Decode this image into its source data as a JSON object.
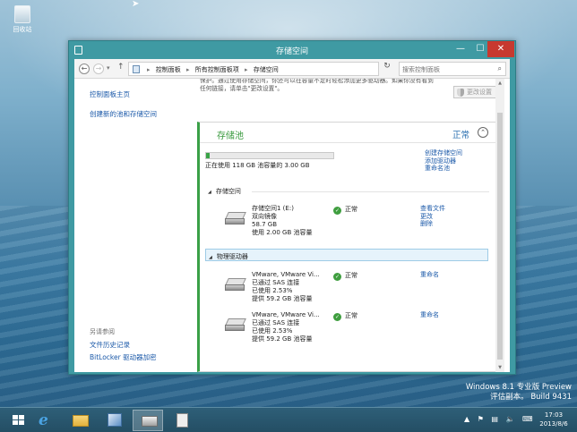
{
  "desktop": {
    "recycle_bin_label": "回收站",
    "watermark_line1": "Windows 8.1 专业版 Preview",
    "watermark_line2": "评估副本。 Build 9431"
  },
  "window": {
    "title": "存储空间",
    "close_glyph": "✕",
    "min_glyph": "—",
    "max_glyph": "☐"
  },
  "address": {
    "crumbs": [
      "控制面板",
      "所有控制面板项",
      "存储空间"
    ],
    "search_placeholder": "搜索控制面板"
  },
  "left_nav": {
    "links": [
      "控制面板主页",
      "创建新的池和存储空间"
    ],
    "see_also_heading": "另请参阅",
    "see_also_links": [
      "文件历史记录",
      "BitLocker 驱动器加密"
    ]
  },
  "intro": {
    "text": "保护。通过使用存储空间，你还可以在容量不足时轻松添加更多驱动器。如果你没有看到任何链接，请单击\"更改设置\"。",
    "change_settings_label": "更改设置"
  },
  "pool": {
    "title": "存储池",
    "status": "正常",
    "usage_fraction": 0.025,
    "usage_text": "正在使用 118 GB 池容量的 3.00 GB",
    "links": [
      "创建存储空间",
      "添加驱动器",
      "重命名池"
    ],
    "spaces_heading": "存储空间",
    "physical_heading": "物理驱动器",
    "spaces": [
      {
        "lines": [
          "存储空间1 (E:)",
          "双向镜像",
          "58.7 GB",
          "使用 2.00 GB 池容量"
        ],
        "status": "正常",
        "links": [
          "查看文件",
          "更改",
          "删除"
        ]
      }
    ],
    "drives": [
      {
        "lines": [
          "VMware, VMware Vi...",
          "已通过 SAS 连接",
          "已使用 2.53%",
          "提供 59.2 GB 池容量"
        ],
        "status": "正常",
        "links": [
          "重命名"
        ]
      },
      {
        "lines": [
          "VMware, VMware Vi...",
          "已通过 SAS 连接",
          "已使用 2.53%",
          "提供 59.2 GB 池容量"
        ],
        "status": "正常",
        "links": [
          "重命名"
        ]
      }
    ]
  },
  "clock": {
    "time": "17:03",
    "date": "2013/8/6"
  },
  "colors": {
    "accent_green": "#3aa047",
    "link_blue": "#1a58a8",
    "window_frame": "#3f9aa3",
    "close_red": "#c7392f"
  }
}
